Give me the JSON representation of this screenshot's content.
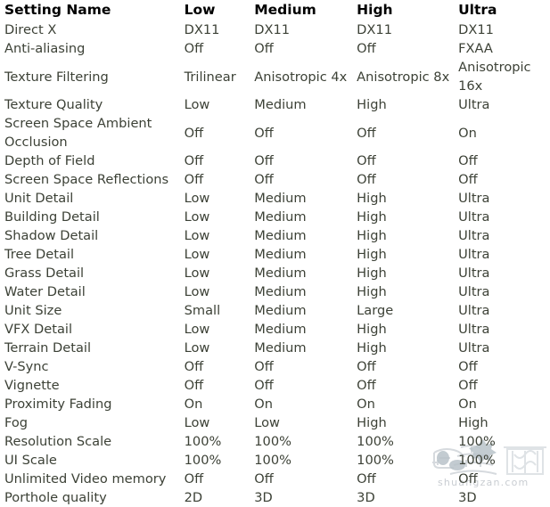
{
  "table": {
    "columns": [
      {
        "key": "name",
        "label": "Setting Name"
      },
      {
        "key": "low",
        "label": "Low"
      },
      {
        "key": "medium",
        "label": "Medium"
      },
      {
        "key": "high",
        "label": "High"
      },
      {
        "key": "ultra",
        "label": "Ultra"
      }
    ],
    "rows": [
      {
        "name": "Direct X",
        "low": "DX11",
        "medium": "DX11",
        "high": "DX11",
        "ultra": "DX11"
      },
      {
        "name": "Anti-aliasing",
        "low": "Off",
        "medium": "Off",
        "high": "Off",
        "ultra": "FXAA"
      },
      {
        "name": "Texture Filtering",
        "low": "Trilinear",
        "medium": "Anisotropic 4x",
        "high": "Anisotropic 8x",
        "ultra": "Anisotropic 16x"
      },
      {
        "name": "Texture Quality",
        "low": "Low",
        "medium": "Medium",
        "high": "High",
        "ultra": "Ultra"
      },
      {
        "name": "Screen Space Ambient Occlusion",
        "low": "Off",
        "medium": "Off",
        "high": "Off",
        "ultra": "On"
      },
      {
        "name": "Depth of Field",
        "low": "Off",
        "medium": "Off",
        "high": "Off",
        "ultra": "Off"
      },
      {
        "name": "Screen Space Reflections",
        "low": "Off",
        "medium": "Off",
        "high": "Off",
        "ultra": "Off"
      },
      {
        "name": "Unit Detail",
        "low": "Low",
        "medium": "Medium",
        "high": "High",
        "ultra": "Ultra"
      },
      {
        "name": "Building Detail",
        "low": "Low",
        "medium": "Medium",
        "high": "High",
        "ultra": "Ultra"
      },
      {
        "name": "Shadow Detail",
        "low": "Low",
        "medium": "Medium",
        "high": "High",
        "ultra": "Ultra"
      },
      {
        "name": "Tree Detail",
        "low": "Low",
        "medium": "Medium",
        "high": "High",
        "ultra": "Ultra"
      },
      {
        "name": "Grass Detail",
        "low": "Low",
        "medium": "Medium",
        "high": "High",
        "ultra": "Ultra"
      },
      {
        "name": "Water Detail",
        "low": "Low",
        "medium": "Medium",
        "high": "High",
        "ultra": "Ultra"
      },
      {
        "name": "Unit Size",
        "low": "Small",
        "medium": "Medium",
        "high": "Large",
        "ultra": "Ultra"
      },
      {
        "name": "VFX Detail",
        "low": "Low",
        "medium": "Medium",
        "high": "High",
        "ultra": "Ultra"
      },
      {
        "name": "Terrain Detail",
        "low": "Low",
        "medium": "Medium",
        "high": "High",
        "ultra": "Ultra"
      },
      {
        "name": "V-Sync",
        "low": "Off",
        "medium": "Off",
        "high": "Off",
        "ultra": "Off"
      },
      {
        "name": "Vignette",
        "low": "Off",
        "medium": "Off",
        "high": "Off",
        "ultra": "Off"
      },
      {
        "name": "Proximity Fading",
        "low": "On",
        "medium": "On",
        "high": "On",
        "ultra": "On"
      },
      {
        "name": "Fog",
        "low": "Low",
        "medium": "Low",
        "high": "High",
        "ultra": "High"
      },
      {
        "name": "Resolution Scale",
        "low": "100%",
        "medium": "100%",
        "high": "100%",
        "ultra": "100%"
      },
      {
        "name": "UI Scale",
        "low": "100%",
        "medium": "100%",
        "high": "100%",
        "ultra": "100%"
      },
      {
        "name": "Unlimited Video memory",
        "low": "Off",
        "medium": "Off",
        "high": "Off",
        "ultra": "Off"
      },
      {
        "name": "Porthole quality",
        "low": "2D",
        "medium": "3D",
        "high": "3D",
        "ultra": "3D"
      }
    ]
  },
  "watermark": {
    "site": "shuangzan.com",
    "color": "#c9cdd2"
  },
  "colors": {
    "background": "#ffffff",
    "header_text": "#000000",
    "body_text": "#3c4136"
  }
}
